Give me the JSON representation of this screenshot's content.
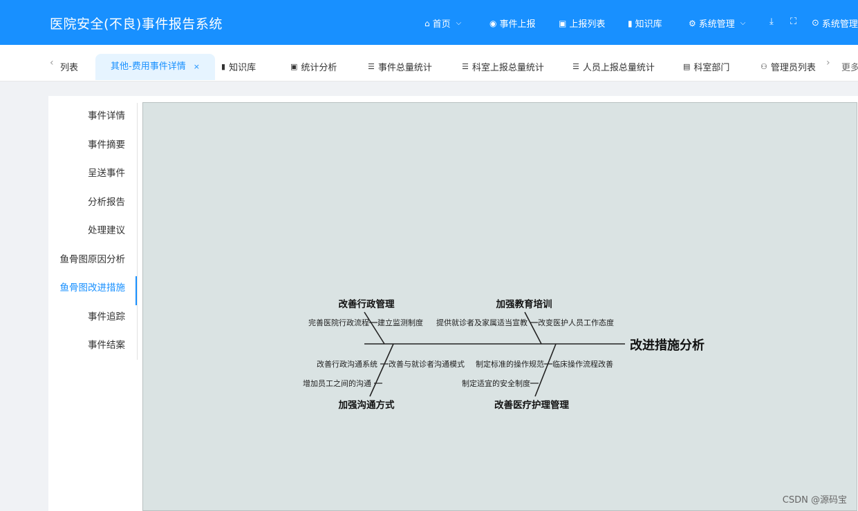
{
  "app": {
    "title": "医院安全(不良)事件报告系统"
  },
  "topnav": [
    {
      "icon": "⌂",
      "label": "首页",
      "chevron": true
    },
    {
      "icon": "◉",
      "label": "事件上报",
      "chevron": false
    },
    {
      "icon": "▣",
      "label": "上报列表",
      "chevron": false
    },
    {
      "icon": "▮",
      "label": "知识库",
      "chevron": false
    },
    {
      "icon": "⚙",
      "label": "系统管理",
      "chevron": true
    }
  ],
  "topnav_right": {
    "download_icon": "⤓",
    "fullscreen_icon": "⛶",
    "user_icon": "⊙",
    "user_label": "系统管理"
  },
  "tabs": [
    {
      "label": "列表",
      "icon": ""
    },
    {
      "label": "其他-费用事件详情",
      "icon": "",
      "active": true,
      "close": "×"
    },
    {
      "label": "知识库",
      "icon": "▮"
    },
    {
      "label": "统计分析",
      "icon": "▣"
    },
    {
      "label": "事件总量统计",
      "icon": "☰"
    },
    {
      "label": "科室上报总量统计",
      "icon": "☰"
    },
    {
      "label": "人员上报总量统计",
      "icon": "☰"
    },
    {
      "label": "科室部门",
      "icon": "▤"
    },
    {
      "label": "管理员列表",
      "icon": "⚇"
    }
  ],
  "tabs_more": "更多",
  "sidemenu": [
    {
      "label": "事件详情"
    },
    {
      "label": "事件摘要"
    },
    {
      "label": "呈送事件"
    },
    {
      "label": "分析报告"
    },
    {
      "label": "处理建议"
    },
    {
      "label": "鱼骨图原因分析"
    },
    {
      "label": "鱼骨图改进措施",
      "active": true
    },
    {
      "label": "事件追踪"
    },
    {
      "label": "事件结案"
    }
  ],
  "fishbone": {
    "head": "改进措施分析",
    "top_left": {
      "title": "改善行政管理",
      "items": [
        "完善医院行政流程",
        "建立监测制度"
      ]
    },
    "top_right": {
      "title": "加强教育培训",
      "items": [
        "提供就诊者及家属适当宣教",
        "改变医护人员工作态度"
      ]
    },
    "bottom_left": {
      "title": "加强沟通方式",
      "items": [
        "改善行政沟通系统",
        "改善与就诊者沟通模式",
        "增加员工之间的沟通"
      ]
    },
    "bottom_right": {
      "title": "改善医疗护理管理",
      "items": [
        "制定标准的操作规范",
        "临床操作流程改善",
        "制定适宜的安全制度"
      ]
    }
  },
  "watermark": "CSDN @源码宝"
}
